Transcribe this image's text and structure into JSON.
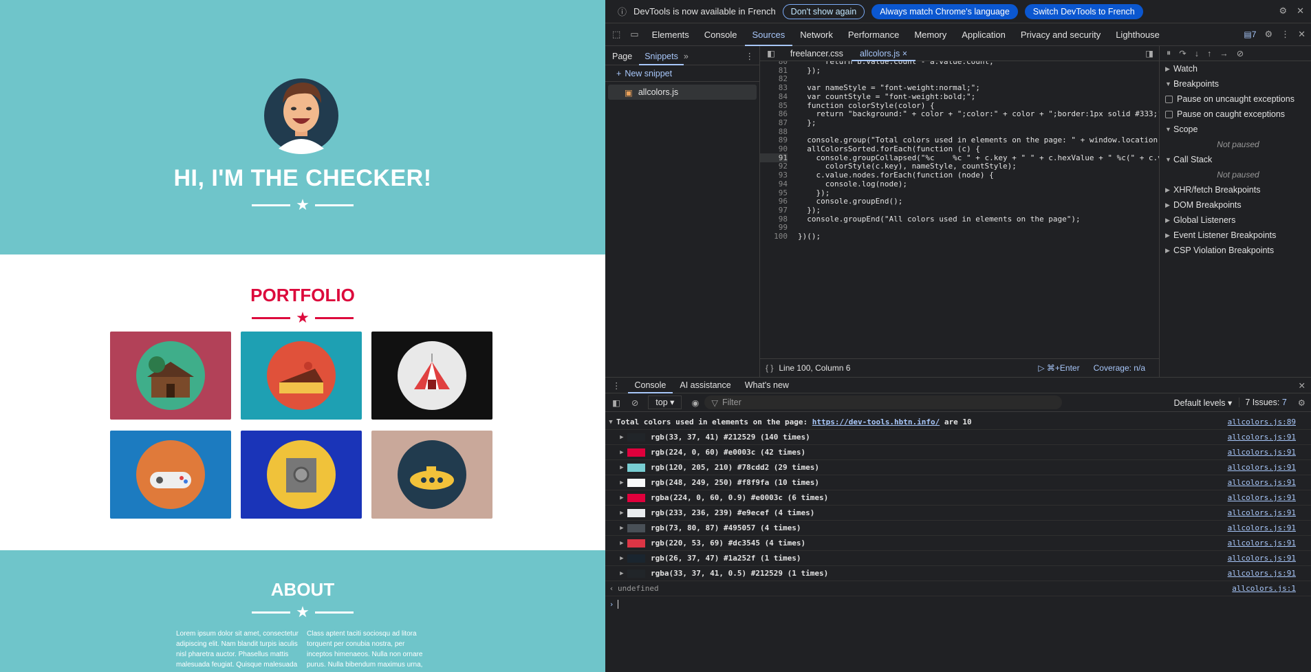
{
  "site": {
    "hero_title": "HI, I'M THE CHECKER!",
    "portfolio_title": "PORTFOLIO",
    "about_title": "ABOUT",
    "about_left": "Lorem ipsum dolor sit amet, consectetur adipiscing elit. Nam blandit turpis iaculis nisl pharetra auctor. Phasellus mattis malesuada feugiat. Quisque malesuada",
    "about_right": "Class aptent taciti sociosqu ad litora torquent per conubia nostra, per inceptos himenaeos. Nulla non ornare purus. Nulla bibendum maximus urna,",
    "tiles": [
      {
        "bg": "#b24158",
        "circle": "#3fae8a",
        "icon": "cabin-icon"
      },
      {
        "bg": "#1ea0b3",
        "circle": "#e0513a",
        "icon": "cake-icon"
      },
      {
        "bg": "#111111",
        "circle": "#e9e9e9",
        "icon": "circus-tent-icon"
      },
      {
        "bg": "#1c7bc0",
        "circle": "#e07a3a",
        "icon": "game-controller-icon"
      },
      {
        "bg": "#1a34b8",
        "circle": "#f0c23a",
        "icon": "safe-icon"
      },
      {
        "bg": "#c9a89a",
        "circle": "#213b4e",
        "icon": "submarine-icon"
      }
    ]
  },
  "devtools": {
    "infobar": {
      "text": "DevTools is now available in French",
      "btn1": "Don't show again",
      "btn2": "Always match Chrome's language",
      "btn3": "Switch DevTools to French"
    },
    "tabs": [
      "Elements",
      "Console",
      "Sources",
      "Network",
      "Performance",
      "Memory",
      "Application",
      "Privacy and security",
      "Lighthouse"
    ],
    "issues_badge": "7",
    "nav": {
      "tab_page": "Page",
      "tab_snippets": "Snippets",
      "new_snippet": "New snippet",
      "file": "allcolors.js"
    },
    "editor_tabs": [
      "freelancer.css",
      "allcolors.js"
    ],
    "status": {
      "position": "Line 100, Column 6",
      "run": "⌘+Enter",
      "coverage": "Coverage: n/a"
    },
    "code_lines": [
      {
        "n": "80",
        "t": "      return b.value.count - a.value.count;"
      },
      {
        "n": "81",
        "t": "  });"
      },
      {
        "n": "82",
        "t": ""
      },
      {
        "n": "83",
        "t": "  var nameStyle = \"font-weight:normal;\";"
      },
      {
        "n": "84",
        "t": "  var countStyle = \"font-weight:bold;\";"
      },
      {
        "n": "85",
        "t": "  function colorStyle(color) {"
      },
      {
        "n": "86",
        "t": "    return \"background:\" + color + \";color:\" + color + \";border:1px solid #333;\""
      },
      {
        "n": "87",
        "t": "  };"
      },
      {
        "n": "88",
        "t": ""
      },
      {
        "n": "89",
        "t": "  console.group(\"Total colors used in elements on the page: \" + window.location."
      },
      {
        "n": "90",
        "t": "  allColorsSorted.forEach(function (c) {"
      },
      {
        "n": "91",
        "t": "    console.groupCollapsed(\"%c    %c \" + c.key + \" \" + c.hexValue + \" %c(\" + c.v"
      },
      {
        "n": "92",
        "t": "      colorStyle(c.key), nameStyle, countStyle);"
      },
      {
        "n": "93",
        "t": "    c.value.nodes.forEach(function (node) {"
      },
      {
        "n": "94",
        "t": "      console.log(node);"
      },
      {
        "n": "95",
        "t": "    });"
      },
      {
        "n": "96",
        "t": "    console.groupEnd();"
      },
      {
        "n": "97",
        "t": "  });"
      },
      {
        "n": "98",
        "t": "  console.groupEnd(\"All colors used in elements on the page\");"
      },
      {
        "n": "99",
        "t": ""
      },
      {
        "n": "100",
        "t": "})();"
      }
    ],
    "sidebar": [
      "Watch",
      "Breakpoints",
      "Pause on uncaught exceptions",
      "Pause on caught exceptions",
      "Scope",
      "Not paused",
      "Call Stack",
      "Not paused",
      "XHR/fetch Breakpoints",
      "DOM Breakpoints",
      "Global Listeners",
      "Event Listener Breakpoints",
      "CSP Violation Breakpoints"
    ],
    "console": {
      "tabs": [
        "Console",
        "AI assistance",
        "What's new"
      ],
      "context": "top",
      "filter_placeholder": "Filter",
      "levels": "Default levels",
      "issues": "7 Issues:",
      "issues_count": "7",
      "group_prefix": "Total colors used in elements on the page:",
      "group_url": "https://dev-tools.hbtn.info/",
      "group_suffix": "are 10",
      "group_src": "allcolors.js:89",
      "rows": [
        {
          "color": "#212529",
          "text": "rgb(33, 37, 41) #212529 (140 times)",
          "src": "allcolors.js:91"
        },
        {
          "color": "#e0003c",
          "text": "rgb(224, 0, 60) #e0003c (42 times)",
          "src": "allcolors.js:91"
        },
        {
          "color": "#78cdd2",
          "text": "rgb(120, 205, 210) #78cdd2 (29 times)",
          "src": "allcolors.js:91"
        },
        {
          "color": "#f8f9fa",
          "text": "rgb(248, 249, 250) #f8f9fa (10 times)",
          "src": "allcolors.js:91"
        },
        {
          "color": "#e0003c",
          "text": "rgba(224, 0, 60, 0.9) #e0003c (6 times)",
          "src": "allcolors.js:91"
        },
        {
          "color": "#e9ecef",
          "text": "rgb(233, 236, 239) #e9ecef (4 times)",
          "src": "allcolors.js:91"
        },
        {
          "color": "#495057",
          "text": "rgb(73, 80, 87) #495057 (4 times)",
          "src": "allcolors.js:91"
        },
        {
          "color": "#dc3545",
          "text": "rgb(220, 53, 69) #dc3545 (4 times)",
          "src": "allcolors.js:91"
        },
        {
          "color": "#1a252f",
          "text": "rgb(26, 37, 47) #1a252f (1 times)",
          "src": "allcolors.js:91"
        },
        {
          "color": "#212529",
          "text": "rgba(33, 37, 41, 0.5) #212529 (1 times)",
          "src": "allcolors.js:91"
        }
      ],
      "result": "undefined",
      "result_src": "allcolors.js:1"
    }
  }
}
